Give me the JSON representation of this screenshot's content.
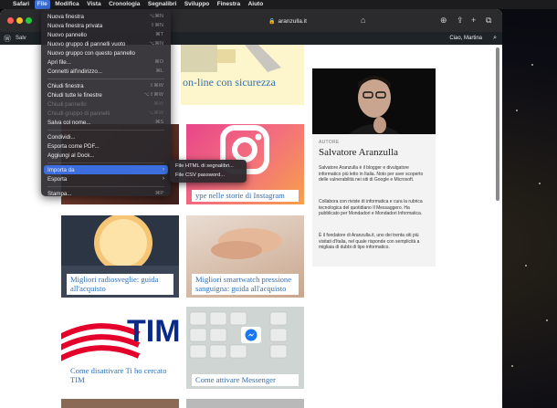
{
  "menubar": {
    "app": "Safari",
    "items": [
      "File",
      "Modifica",
      "Vista",
      "Cronologia",
      "Segnalibri",
      "Sviluppo",
      "Finestra",
      "Aiuto"
    ]
  },
  "browser": {
    "url": "aranzulla.it"
  },
  "adminbar": {
    "site": "Salv",
    "user": "Ciao, Martina"
  },
  "file_menu": {
    "groups": [
      [
        {
          "label": "Nuova finestra",
          "shortcut": "⌥⌘N",
          "disabled": false
        },
        {
          "label": "Nuova finestra privata",
          "shortcut": "⇧⌘N",
          "disabled": false
        },
        {
          "label": "Nuovo pannello",
          "shortcut": "⌘T",
          "disabled": false
        },
        {
          "label": "Nuovo gruppo di pannelli vuoto",
          "shortcut": "⌥⌘N",
          "disabled": false
        },
        {
          "label": "Nuovo gruppo con questo pannello",
          "shortcut": "",
          "disabled": false
        },
        {
          "label": "Apri file...",
          "shortcut": "⌘O",
          "disabled": false
        },
        {
          "label": "Connetti all'indirizzo...",
          "shortcut": "⌘L",
          "disabled": false
        }
      ],
      [
        {
          "label": "Chiudi finestra",
          "shortcut": "⇧⌘W",
          "disabled": false
        },
        {
          "label": "Chiudi tutte le finestre",
          "shortcut": "⌥⇧⌘W",
          "disabled": false
        },
        {
          "label": "Chiudi pannello",
          "shortcut": "⌘W",
          "disabled": true
        },
        {
          "label": "Chiudi gruppo di pannelli",
          "shortcut": "⌥⌘W",
          "disabled": true
        },
        {
          "label": "Salva col nome...",
          "shortcut": "⌘S",
          "disabled": false
        }
      ],
      [
        {
          "label": "Condividi...",
          "shortcut": "",
          "disabled": false
        },
        {
          "label": "Esporta come PDF...",
          "shortcut": "",
          "disabled": false
        },
        {
          "label": "Aggiungi al Dock...",
          "shortcut": "",
          "disabled": false
        }
      ],
      [
        {
          "label": "Importa da",
          "shortcut": "",
          "disabled": false,
          "submenu": true,
          "highlight": true
        },
        {
          "label": "Esporta",
          "shortcut": "",
          "disabled": false,
          "submenu": true
        }
      ],
      [
        {
          "label": "Stampa...",
          "shortcut": "⌘P",
          "disabled": false
        }
      ]
    ]
  },
  "submenu": {
    "items": [
      "File HTML di segnalibri...",
      "File CSV password..."
    ]
  },
  "page": {
    "hero_caption": "on-line con sicurezza",
    "cards": [
      {
        "caption": "ype nelle storie di Instagram"
      },
      {
        "caption": "Migliori radiosveglie: guida all'acquisto"
      },
      {
        "caption": "Migliori smartwatch pressione sanguigna: guida all'acquisto"
      },
      {
        "caption": "Come disattivare Ti ho cercato TIM"
      },
      {
        "caption": "Come attivare Messenger"
      }
    ],
    "tim_logo": "TIM",
    "author": {
      "label": "AUTORE",
      "name": "Salvatore Aranzulla",
      "bio": [
        "Salvatore Aranzulla è il blogger e divulgatore informatico più letto in Italia. Noto per aver scoperto delle vulnerabilità nei siti di Google e Microsoft.",
        "Collabora con riviste di informatica e cura la rubrica tecnologica del quotidiano Il Messaggero. Ha pubblicato per Mondadori e Mondadori Informatica.",
        "È il fondatore di Aranzulla.it, uno dei trenta siti più visitati d'Italia, nel quale risponde con semplicità a migliaia di dubbi di tipo informatico."
      ]
    }
  }
}
